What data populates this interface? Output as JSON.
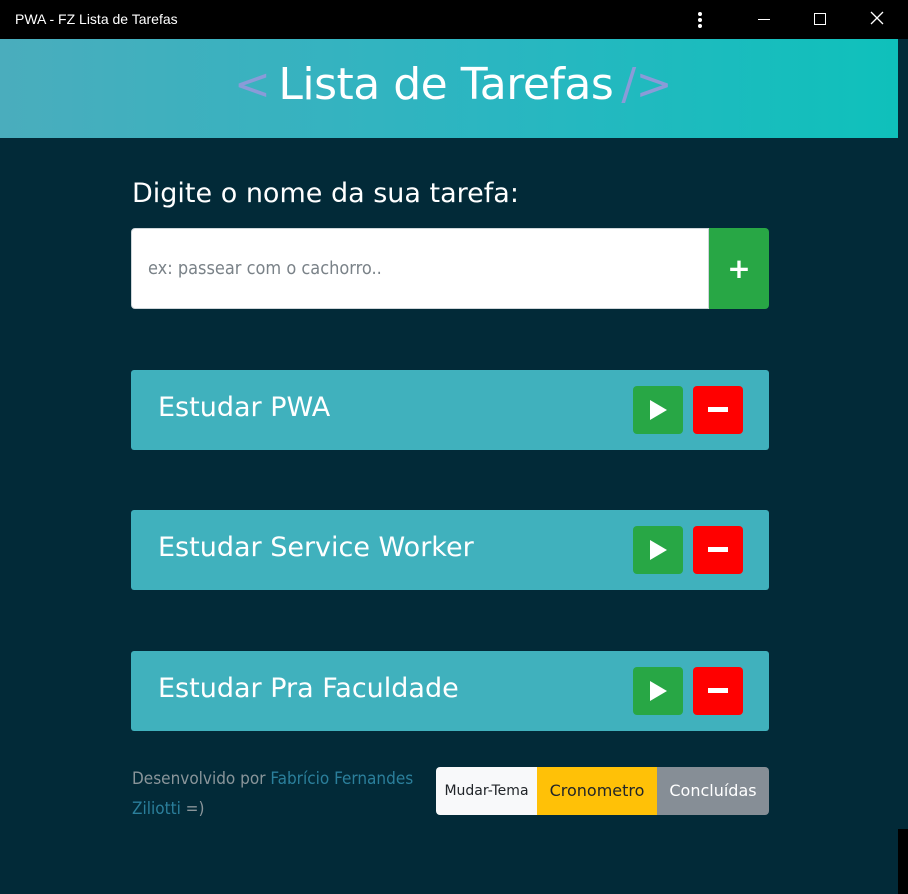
{
  "window": {
    "title": "PWA - FZ Lista de Tarefas",
    "icons": [
      "more-icon",
      "minimize-icon",
      "maximize-icon",
      "close-icon"
    ]
  },
  "header": {
    "open_bracket": "<",
    "title": "Lista de Tarefas",
    "close_bracket": "/>",
    "bracket_color": "#8a9bd8"
  },
  "form": {
    "label": "Digite o nome da sua tarefa:",
    "placeholder": "ex: passear com o cachorro..",
    "add_label": "+"
  },
  "tasks": [
    {
      "name": "Estudar PWA"
    },
    {
      "name": "Estudar Service Worker"
    },
    {
      "name": "Estudar Pra Faculdade"
    }
  ],
  "footer": {
    "prefix": "Desenvolvido por ",
    "author": "Fabrício Fernandes Ziliotti",
    "suffix": " =)"
  },
  "actions": {
    "theme": "Mudar-Tema",
    "crono": "Cronometro",
    "done": "Concluídas"
  },
  "colors": {
    "background": "#022a38",
    "task": "#40b1bd",
    "play": "#28a745",
    "delete": "#ff0000",
    "crono": "#ffc107",
    "done": "#868e96"
  }
}
